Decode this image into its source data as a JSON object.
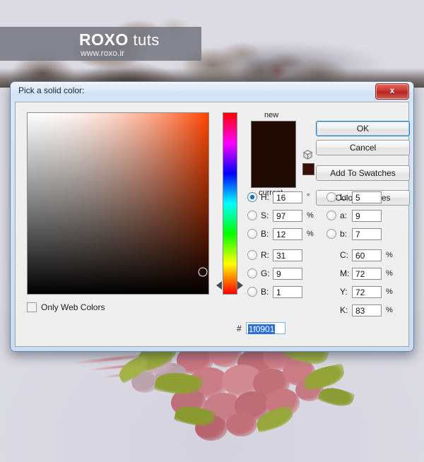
{
  "background": {
    "watermark": {
      "logo_main": "RO",
      "logo_mid": "XO",
      "logo_suffix": " tuts",
      "url": "www.roxo.ir"
    }
  },
  "dialog": {
    "title": "Pick a solid color:",
    "close_label": "x",
    "labels": {
      "new": "new",
      "current": "current",
      "hash": "#",
      "only_web_colors": "Only Web Colors"
    },
    "buttons": {
      "ok": "OK",
      "cancel": "Cancel",
      "add_to_swatches": "Add To Swatches",
      "color_libraries": "Color Libraries"
    },
    "swatches": {
      "new_color": "#1f0901",
      "current_color": "#1f0901",
      "alt_color": "#3a0f0a"
    },
    "selected_model": "H",
    "hex": "1f0901",
    "only_web_colors_checked": false,
    "hsb": [
      {
        "key": "H",
        "label": "H:",
        "value": "16",
        "unit": "°",
        "selected": true
      },
      {
        "key": "S",
        "label": "S:",
        "value": "97",
        "unit": "%",
        "selected": false
      },
      {
        "key": "B",
        "label": "B:",
        "value": "12",
        "unit": "%",
        "selected": false
      }
    ],
    "rgb": [
      {
        "key": "R",
        "label": "R:",
        "value": "31",
        "unit": "",
        "selected": false
      },
      {
        "key": "G",
        "label": "G:",
        "value": "9",
        "unit": "",
        "selected": false
      },
      {
        "key": "B",
        "label": "B:",
        "value": "1",
        "unit": "",
        "selected": false
      }
    ],
    "lab": [
      {
        "key": "L",
        "label": "L:",
        "value": "5",
        "unit": "",
        "selected": false
      },
      {
        "key": "a",
        "label": "a:",
        "value": "9",
        "unit": "",
        "selected": false
      },
      {
        "key": "b",
        "label": "b:",
        "value": "7",
        "unit": "",
        "selected": false
      }
    ],
    "cmyk": [
      {
        "key": "C",
        "label": "C:",
        "value": "60",
        "unit": "%"
      },
      {
        "key": "M",
        "label": "M:",
        "value": "72",
        "unit": "%"
      },
      {
        "key": "Y",
        "label": "Y:",
        "value": "72",
        "unit": "%"
      },
      {
        "key": "K",
        "label": "K:",
        "value": "83",
        "unit": "%"
      }
    ],
    "picker": {
      "hue_degrees": 16,
      "saturation_percent": 97,
      "brightness_percent": 12,
      "cursor_x_percent": 97,
      "cursor_y_percent": 88,
      "hue_marker_percent": 95.6,
      "hue_color": "#ff4400"
    }
  }
}
